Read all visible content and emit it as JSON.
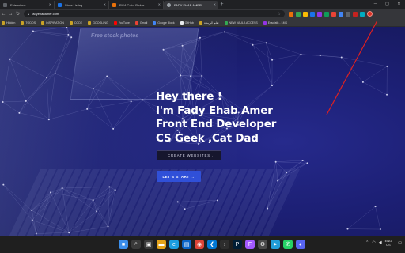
{
  "browser": {
    "tabs": [
      {
        "title": "Extensions",
        "color": "#5f6368"
      },
      {
        "title": "Store Listing",
        "color": "#1a73e8"
      },
      {
        "title": "RGA Color Picker",
        "color": "#e8710a"
      },
      {
        "title": "FADY EHAB AMER",
        "color": "#9aa0a6"
      }
    ],
    "url": "fadyehabamer.com",
    "bookmarks": [
      {
        "label": "Hidden",
        "icon": "folder"
      },
      {
        "label": "TODOS",
        "icon": "folder"
      },
      {
        "label": "INSPIRATION",
        "icon": "folder"
      },
      {
        "label": "CODE",
        "icon": "folder"
      },
      {
        "label": "GOOGLING",
        "icon": "folder"
      },
      {
        "label": "YouTube",
        "icon": "youtube"
      },
      {
        "label": "Gmail",
        "icon": "gmail"
      },
      {
        "label": "Google Block",
        "icon": "google"
      },
      {
        "label": "GitHub",
        "icon": "github"
      },
      {
        "label": "تعلم البرمجة",
        "icon": "folder"
      },
      {
        "label": "NEW VAULA ACCESS",
        "icon": "green"
      },
      {
        "label": "Eraofath - LMS",
        "icon": "purple"
      }
    ],
    "extension_colors": [
      "#e8710a",
      "#34a853",
      "#fbbc04",
      "#1a73e8",
      "#9334e6",
      "#0f9d58",
      "#ea4335",
      "#4285f4",
      "#5f6368",
      "#c5221f",
      "#00acc1"
    ]
  },
  "hero": {
    "laptop_text": "Free stock photos",
    "heading_lines": [
      "Hey there !",
      "I'm Fady Ehab Amer",
      "Front End Developer",
      "CS Geek ,Cat Dad"
    ],
    "create_websites_label": "I CREATE WEBSITES .",
    "lets_start_label": "LET'S START →"
  },
  "taskbar": {
    "apps": [
      {
        "name": "windows",
        "color": "#3b8eea",
        "glyph": "■"
      },
      {
        "name": "search",
        "color": "#3a3a3a",
        "glyph": "⌕"
      },
      {
        "name": "task-view",
        "color": "#3a3a3a",
        "glyph": "▣"
      },
      {
        "name": "file-explorer",
        "color": "#e3a21a",
        "glyph": "▬"
      },
      {
        "name": "edge",
        "color": "#1b9de2",
        "glyph": "e"
      },
      {
        "name": "store",
        "color": "#0a64c8",
        "glyph": "▤"
      },
      {
        "name": "chrome",
        "color": "#db4437",
        "glyph": "◉"
      },
      {
        "name": "vscode",
        "color": "#0078d4",
        "glyph": "❮"
      },
      {
        "name": "terminal",
        "color": "#2d2d2d",
        "glyph": "›"
      },
      {
        "name": "photoshop",
        "color": "#001e36",
        "glyph": "P"
      },
      {
        "name": "figma",
        "color": "#a259ff",
        "glyph": "F"
      },
      {
        "name": "settings",
        "color": "#4a4a4a",
        "glyph": "⚙"
      },
      {
        "name": "telegram",
        "color": "#229ed9",
        "glyph": "➤"
      },
      {
        "name": "whatsapp",
        "color": "#25d366",
        "glyph": "✆"
      },
      {
        "name": "discord",
        "color": "#5865f2",
        "glyph": "◐"
      }
    ],
    "lang_top": "ENG",
    "lang_bottom": "US",
    "time": "",
    "date": ""
  },
  "colors": {
    "hero_bg": "#1c1f74",
    "primary_button": "#3050d8",
    "annotation_arrow": "#e02020"
  }
}
